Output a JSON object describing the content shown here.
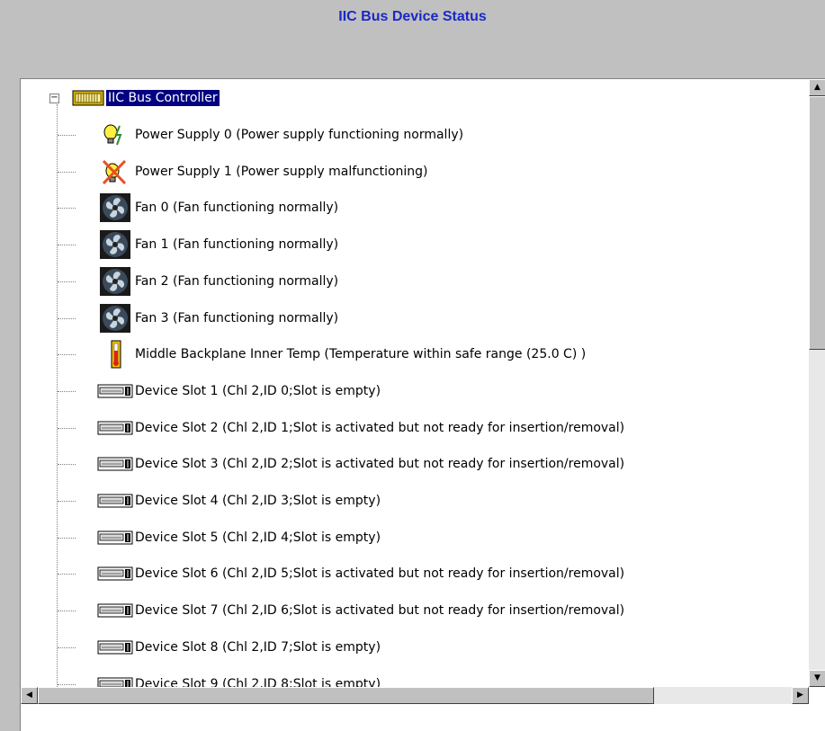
{
  "title": "IIC Bus Device Status",
  "tree": {
    "root": {
      "label": "IIC Bus Controller",
      "icon": "controller-icon",
      "expanded": true
    },
    "items": [
      {
        "label": "Power Supply 0 (Power supply functioning normally)",
        "icon": "power-supply-ok-icon"
      },
      {
        "label": "Power Supply 1 (Power supply malfunctioning)",
        "icon": "power-supply-fail-icon"
      },
      {
        "label": "Fan 0 (Fan functioning normally)",
        "icon": "fan-icon"
      },
      {
        "label": "Fan 1 (Fan functioning normally)",
        "icon": "fan-icon"
      },
      {
        "label": "Fan 2 (Fan functioning normally)",
        "icon": "fan-icon"
      },
      {
        "label": "Fan 3 (Fan functioning normally)",
        "icon": "fan-icon"
      },
      {
        "label": "Middle Backplane Inner Temp (Temperature within safe range (25.0 C) )",
        "icon": "thermometer-icon"
      },
      {
        "label": "Device Slot 1 (Chl 2,ID 0;Slot is empty)",
        "icon": "device-slot-icon"
      },
      {
        "label": "Device Slot 2 (Chl 2,ID 1;Slot is activated but not ready for insertion/removal)",
        "icon": "device-slot-icon"
      },
      {
        "label": "Device Slot 3 (Chl 2,ID 2;Slot is activated but not ready for insertion/removal)",
        "icon": "device-slot-icon"
      },
      {
        "label": "Device Slot 4 (Chl 2,ID 3;Slot is empty)",
        "icon": "device-slot-icon"
      },
      {
        "label": "Device Slot 5 (Chl 2,ID 4;Slot is empty)",
        "icon": "device-slot-icon"
      },
      {
        "label": "Device Slot 6 (Chl 2,ID 5;Slot is activated but not ready for insertion/removal)",
        "icon": "device-slot-icon"
      },
      {
        "label": "Device Slot 7 (Chl 2,ID 6;Slot is activated but not ready for insertion/removal)",
        "icon": "device-slot-icon"
      },
      {
        "label": "Device Slot 8 (Chl 2,ID 7;Slot is empty)",
        "icon": "device-slot-icon"
      },
      {
        "label": "Device Slot 9 (Chl 2,ID 8;Slot is empty)",
        "icon": "device-slot-icon"
      }
    ]
  },
  "colors": {
    "title": "#1a28c8",
    "selection": "#000080",
    "background": "#c0c0c0"
  }
}
